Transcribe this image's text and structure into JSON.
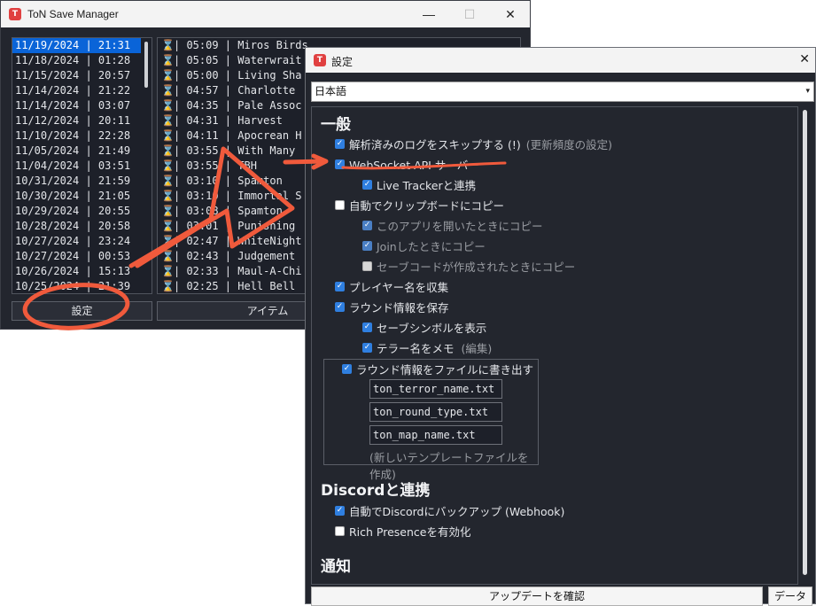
{
  "main_window": {
    "title": "ToN Save Manager",
    "app_icon": "app-logo-icon",
    "minimize_glyph": "—",
    "maximize_glyph": "☐",
    "close_glyph": "✕",
    "dates": [
      "11/19/2024 | 21:31",
      "11/18/2024 | 01:28",
      "11/15/2024 | 20:57",
      "11/14/2024 | 21:22",
      "11/14/2024 | 03:07",
      "11/12/2024 | 20:11",
      "11/10/2024 | 22:28",
      "11/05/2024 | 21:49",
      "11/04/2024 | 03:51",
      "10/31/2024 | 21:59",
      "10/30/2024 | 21:05",
      "10/29/2024 | 20:55",
      "10/28/2024 | 20:58",
      "10/27/2024 | 23:24",
      "10/27/2024 | 00:53",
      "10/26/2024 | 15:13",
      "10/25/2024 | 21:39"
    ],
    "hourglass_glyph": "⌛",
    "rounds": [
      "| 05:09 | Miros Birds",
      "| 05:05 | Waterwrait",
      "| 05:00 | Living Sha",
      "| 04:57 | Charlotte",
      "| 04:35 | Pale Assoc",
      "| 04:31 | Harvest",
      "| 04:11 | Apocrean H",
      "| 03:55 | With Many",
      "| 03:55 | TBH",
      "| 03:10 | Spamton",
      "| 03:10 | Immortal S",
      "| 03:08 | Spamton",
      "| 03:01 | Punishing",
      "| 02:47 | WhiteNight",
      "| 02:43 | Judgement",
      "| 02:33 | Maul-A-Chi",
      "| 02:25 | Hell Bell"
    ],
    "settings_button": "設定",
    "items_button": "アイテム"
  },
  "settings_window": {
    "title": "設定",
    "close_glyph": "✕",
    "language": "日本語",
    "dropdown_glyph": "▾",
    "general": {
      "heading": "一般",
      "skip_parsed": "解析済みのログをスキップする (!)",
      "skip_parsed_note": "(更新頻度の設定)",
      "websocket": "WebSocket API サーバー",
      "live_tracker": "Live Trackerと連携",
      "auto_clipboard": "自動でクリップボードにコピー",
      "copy_on_open": "このアプリを開いたときにコピー",
      "copy_on_join": "Joinしたときにコピー",
      "copy_on_savecode": "セーブコードが作成されたときにコピー",
      "collect_player_names": "プレイヤー名を収集",
      "save_round_info": "ラウンド情報を保存",
      "show_save_symbol": "セーブシンボルを表示",
      "memo_terror_name": "テラー名をメモ",
      "memo_edit_note": "(編集)",
      "export_round_info": "ラウンド情報をファイルに書き出す",
      "file_terror": "ton_terror_name.txt",
      "file_round_type": "ton_round_type.txt",
      "file_map": "ton_map_name.txt",
      "new_template": "(新しいテンプレートファイルを作成)"
    },
    "discord": {
      "heading": "Discordと連携",
      "auto_backup": "自動でDiscordにバックアップ (Webhook)",
      "rich_presence": "Rich Presenceを有効化"
    },
    "notifications": {
      "heading": "通知"
    },
    "check_updates_button": "アップデートを確認",
    "data_button": "データ"
  },
  "colors": {
    "window_bg": "#23262e",
    "selection": "#0a64d8",
    "checkbox_on": "#2f7fe0",
    "annotation_red": "#f05a3c"
  }
}
